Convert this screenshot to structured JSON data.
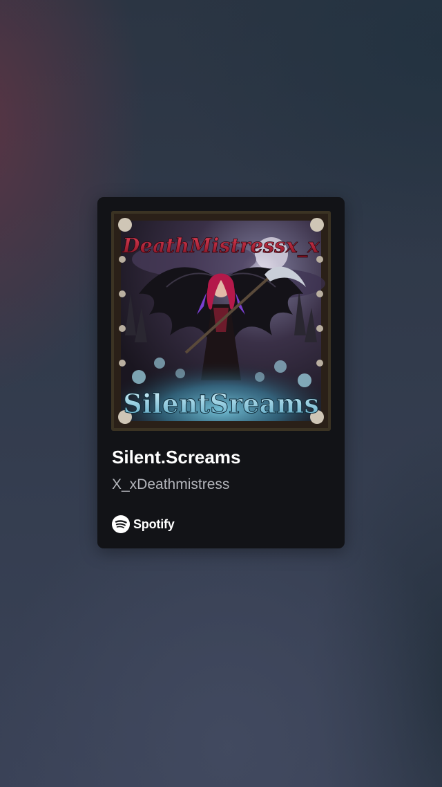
{
  "card": {
    "cover": {
      "alt": "Album cover art",
      "artist_lettering": "DeathMistressx_x",
      "title_lettering": "SilentSreams"
    },
    "title": "Silent.Screams",
    "artist": "X_xDeathmistress",
    "brand": {
      "name": "Spotify",
      "icon": "spotify-logo-icon"
    }
  },
  "colors": {
    "card_background": "#121317",
    "title_text": "#ffffff",
    "artist_text": "#b3b5bb",
    "page_background": "#2f3848"
  }
}
